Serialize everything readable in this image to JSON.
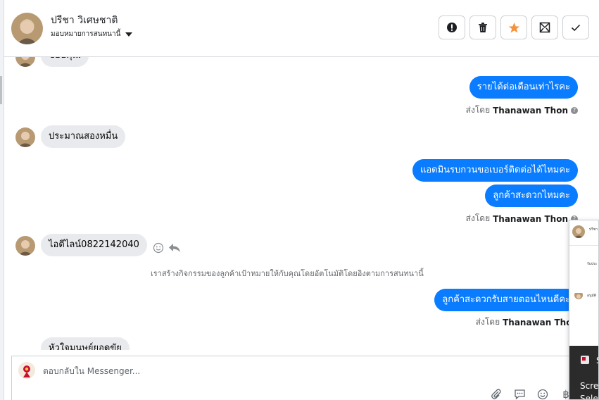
{
  "header": {
    "contact_name": "ปรีชา วิเศษชาติ",
    "assign_label": "มอบหมายการสนทนานี้"
  },
  "actions": [
    {
      "name": "spam-button",
      "icon": "alert-icon"
    },
    {
      "name": "delete-button",
      "icon": "trash-icon"
    },
    {
      "name": "star-button",
      "icon": "star-icon",
      "color": "#f7923b"
    },
    {
      "name": "mark-unread-button",
      "icon": "envelope-icon"
    },
    {
      "name": "done-button",
      "icon": "check-icon"
    }
  ],
  "thread": {
    "partial_top": "ขอบคุณ",
    "out_1": "รายได้ต่อเดือนเท่าไรคะ",
    "sent_by_prefix": "ส่งโดย",
    "sender": "Thanawan Thon",
    "in_1": "ประมาณสองหมื่น",
    "out_2": "แอดมินรบกวนขอเบอร์ติดต่อได้ไหมคะ",
    "out_3": "ลูกค้าสะดวกไหมคะ",
    "in_2": "ไอดีไลน์0822142040",
    "system_note": "เราสร้างกิจกรรมของลูกค้าเป้าหมายให้กับคุณโดยอัตโนมัติโดยอิงตามการสนทนานี้",
    "out_4": "ลูกค้าสะดวกรับสายตอนไหนดีคะ",
    "partial_bottom": "หัวใจมนุษย์ยอดขัย"
  },
  "composer": {
    "placeholder": "ตอบกลับใน Messenger..."
  },
  "float_window": {
    "name_snippet": "ปรีชา",
    "line_1": "รับประ",
    "line_2": "อนุมัติ",
    "dark_label_1": "S",
    "dark_label_2": "Scre",
    "dark_label_3": "Sele"
  },
  "colors": {
    "accent_blue": "#0a7cff",
    "incoming_bubble": "#e9eaed",
    "star_orange": "#f7923b"
  }
}
